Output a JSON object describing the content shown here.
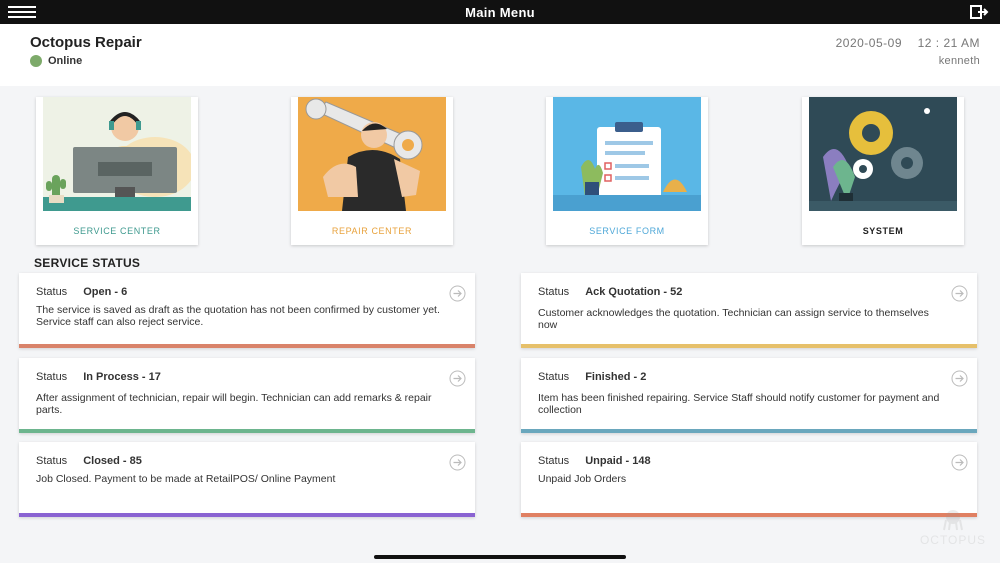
{
  "topbar": {
    "title": "Main Menu"
  },
  "header": {
    "store_name": "Octopus Repair",
    "status": "Online",
    "date": "2020-05-09",
    "time": "12 : 21 AM",
    "user": "kenneth"
  },
  "tiles": [
    {
      "label": "SERVICE CENTER",
      "color": "#3f9a8f"
    },
    {
      "label": "REPAIR CENTER",
      "color": "#e8a23c"
    },
    {
      "label": "SERVICE FORM",
      "color": "#4fa8d8"
    },
    {
      "label": "SYSTEM",
      "color": "#222222"
    }
  ],
  "section_title": "SERVICE STATUS",
  "status_label": "Status",
  "cards": [
    {
      "value": "Open - 6",
      "description": "The service is saved as draft as the quotation has not been confirmed by customer yet. Service staff can also reject service.",
      "color": "#d9836a"
    },
    {
      "value": "Ack Quotation - 52",
      "description": "Customer acknowledges the quotation. Technician can assign service to themselves now",
      "color": "#e6c06a"
    },
    {
      "value": "In Process - 17",
      "description": "After assignment of technician, repair will begin. Technician can add remarks & repair parts.",
      "color": "#6db58e"
    },
    {
      "value": "Finished - 2",
      "description": "Item has been finished repairing. Service Staff should notify customer for payment and collection",
      "color": "#6aa7bd"
    },
    {
      "value": "Closed - 85",
      "description": "Job Closed. Payment to be made at RetailPOS/ Online Payment",
      "color": "#8a63d2"
    },
    {
      "value": "Unpaid - 148",
      "description": "Unpaid Job Orders",
      "color": "#e08062"
    }
  ],
  "watermark": "OCTOPUS"
}
